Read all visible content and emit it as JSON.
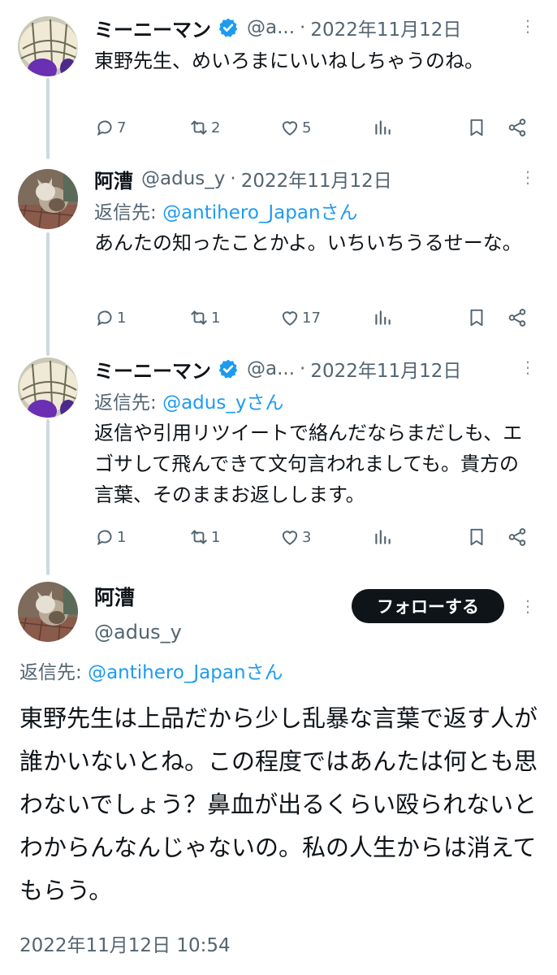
{
  "tweets": [
    {
      "name": "ミーニーマン",
      "handle": "@a...",
      "date": "2022年11月12日",
      "text": "東野先生、めいろまにいいねしちゃうのね。",
      "stats": {
        "replies": "7",
        "retweets": "2",
        "likes": "5"
      }
    },
    {
      "name": "阿漕",
      "handle": "@adus_y",
      "date": "2022年11月12日",
      "reply_prefix": "返信先:",
      "reply_mention": "@antihero_Japanさん",
      "text": "あんたの知ったことかよ。いちいちうるせーな。",
      "stats": {
        "replies": "1",
        "retweets": "1",
        "likes": "17"
      }
    },
    {
      "name": "ミーニーマン",
      "handle": "@a...",
      "date": "2022年11月12日",
      "reply_prefix": "返信先:",
      "reply_mention": "@adus_yさん",
      "text": "返信や引用リツイートで絡んだならまだしも、エゴサして飛んできて文句言われましても。貴方の言葉、そのままお返しします。",
      "stats": {
        "replies": "1",
        "retweets": "1",
        "likes": "3"
      }
    }
  ],
  "main_tweet": {
    "name": "阿漕",
    "handle": "@adus_y",
    "follow_label": "フォローする",
    "reply_prefix": "返信先:",
    "reply_mention": "@antihero_Japanさん",
    "text": "東野先生は上品だから少し乱暴な言葉で返す人が誰かいないとね。この程度ではあんたは何とも思わないでしょう？鼻血が出るくらい殴られないとわからんなんじゃないの。私の人生からは消えてもらう。",
    "timestamp": "2022年11月12日 10:54"
  },
  "separator": "·",
  "more_glyph": "⋮",
  "colors": {
    "accent": "#1d9bf0",
    "secondary": "#536471",
    "thread_line": "#cfd9de"
  }
}
